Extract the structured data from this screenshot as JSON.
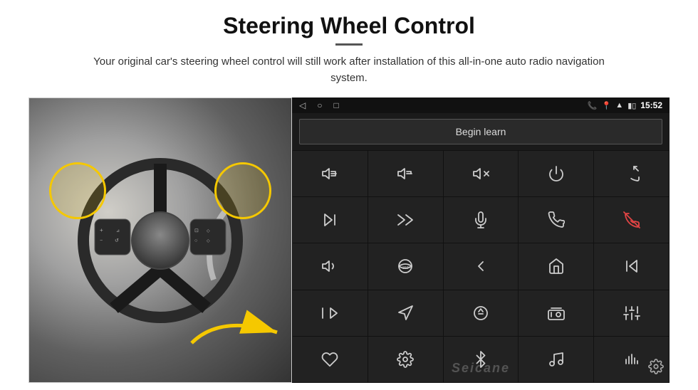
{
  "header": {
    "title": "Steering Wheel Control",
    "divider": true,
    "subtitle": "Your original car's steering wheel control will still work after installation of this all-in-one auto radio navigation system."
  },
  "android_ui": {
    "status_bar": {
      "nav_back": "◁",
      "nav_home": "○",
      "nav_recent": "□",
      "battery_icon": "🔋",
      "signal_icon": "📶",
      "phone_icon": "📞",
      "location_icon": "📍",
      "wifi_icon": "📶",
      "time": "15:52"
    },
    "begin_learn_label": "Begin learn",
    "watermark": "Seicane",
    "icons": [
      {
        "name": "vol-up",
        "row": 1,
        "col": 1
      },
      {
        "name": "vol-down",
        "row": 1,
        "col": 2
      },
      {
        "name": "mute",
        "row": 1,
        "col": 3
      },
      {
        "name": "power",
        "row": 1,
        "col": 4
      },
      {
        "name": "phone-prev",
        "row": 1,
        "col": 5
      },
      {
        "name": "next-track",
        "row": 2,
        "col": 1
      },
      {
        "name": "fast-forward-skip",
        "row": 2,
        "col": 2
      },
      {
        "name": "mic",
        "row": 2,
        "col": 3
      },
      {
        "name": "phone",
        "row": 2,
        "col": 4
      },
      {
        "name": "phone-end",
        "row": 2,
        "col": 5
      },
      {
        "name": "speaker",
        "row": 3,
        "col": 1
      },
      {
        "name": "360-view",
        "row": 3,
        "col": 2
      },
      {
        "name": "back",
        "row": 3,
        "col": 3
      },
      {
        "name": "home",
        "row": 3,
        "col": 4
      },
      {
        "name": "skip-back",
        "row": 3,
        "col": 5
      },
      {
        "name": "fast-forward",
        "row": 4,
        "col": 1
      },
      {
        "name": "navigate",
        "row": 4,
        "col": 2
      },
      {
        "name": "eject",
        "row": 4,
        "col": 3
      },
      {
        "name": "radio",
        "row": 4,
        "col": 4
      },
      {
        "name": "equalizer",
        "row": 4,
        "col": 5
      },
      {
        "name": "mic2",
        "row": 5,
        "col": 1
      },
      {
        "name": "settings2",
        "row": 5,
        "col": 2
      },
      {
        "name": "bluetooth",
        "row": 5,
        "col": 3
      },
      {
        "name": "music",
        "row": 5,
        "col": 4
      },
      {
        "name": "sound-bars",
        "row": 5,
        "col": 5
      }
    ]
  }
}
